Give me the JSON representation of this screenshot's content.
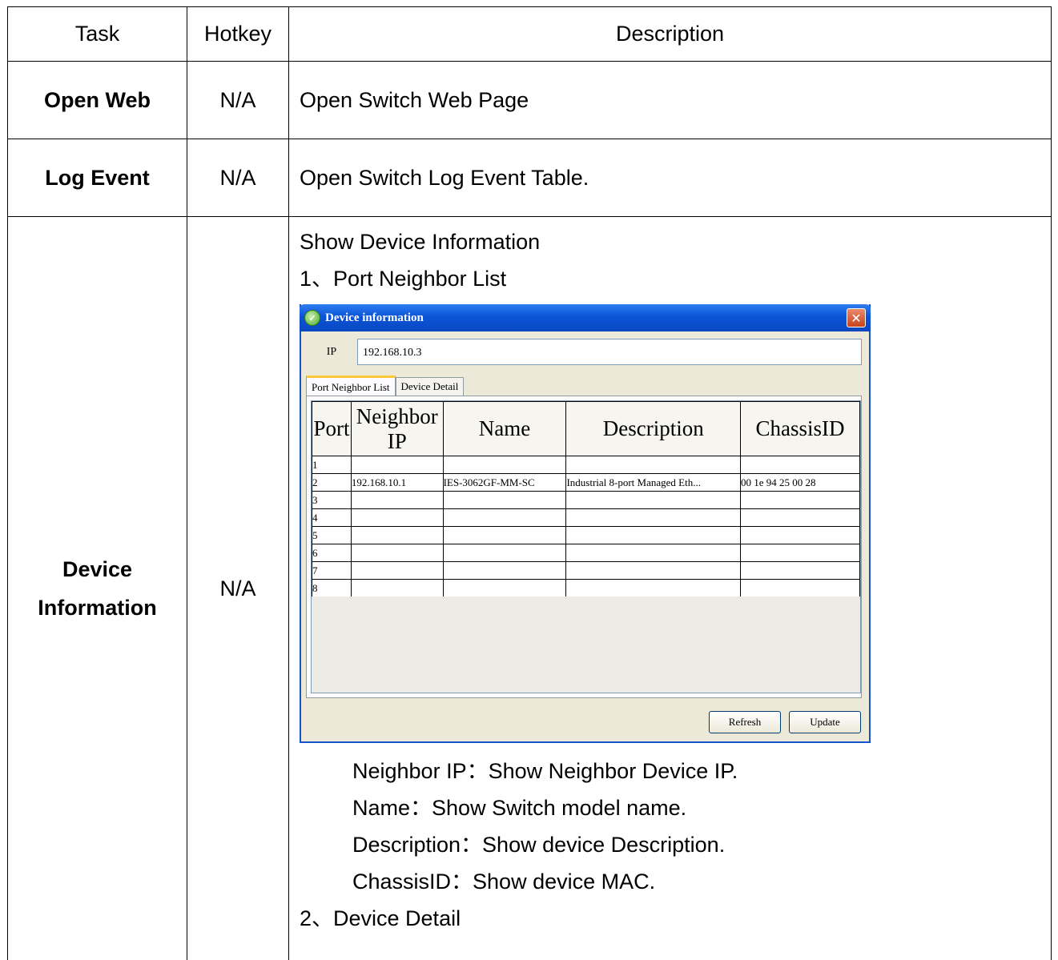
{
  "header": {
    "task": "Task",
    "hotkey": "Hotkey",
    "description": "Description"
  },
  "rows": [
    {
      "task": "Open Web",
      "hotkey": "N/A",
      "description": "Open Switch Web Page"
    },
    {
      "task": "Log Event",
      "hotkey": "N/A",
      "description": "Open Switch Log Event Table."
    }
  ],
  "device_row": {
    "task_line1": "Device",
    "task_line2": "Information",
    "hotkey": "N/A",
    "intro": "Show Device Information",
    "item1": "1、Port Neighbor List",
    "notes": [
      "Neighbor IP：Show Neighbor Device IP.",
      "Name：Show Switch model name.",
      "Description：Show device Description.",
      "ChassisID：Show device MAC."
    ],
    "item2": "2、Device Detail"
  },
  "dialog": {
    "title": "Device information",
    "ip_label": "IP",
    "ip_value": "192.168.10.3",
    "tabs": [
      "Port Neighbor List",
      "Device Detail"
    ],
    "columns": [
      "Port",
      "Neighbor IP",
      "Name",
      "Description",
      "ChassisID"
    ],
    "rows": [
      [
        "1",
        "",
        "",
        "",
        ""
      ],
      [
        "2",
        "192.168.10.1",
        "IES-3062GF-MM-SC",
        "Industrial 8-port Managed Eth...",
        "00 1e 94 25 00 28"
      ],
      [
        "3",
        "",
        "",
        "",
        ""
      ],
      [
        "4",
        "",
        "",
        "",
        ""
      ],
      [
        "5",
        "",
        "",
        "",
        ""
      ],
      [
        "6",
        "",
        "",
        "",
        ""
      ],
      [
        "7",
        "",
        "",
        "",
        ""
      ],
      [
        "8",
        "",
        "",
        "",
        ""
      ]
    ],
    "buttons": {
      "refresh": "Refresh",
      "update": "Update"
    }
  }
}
